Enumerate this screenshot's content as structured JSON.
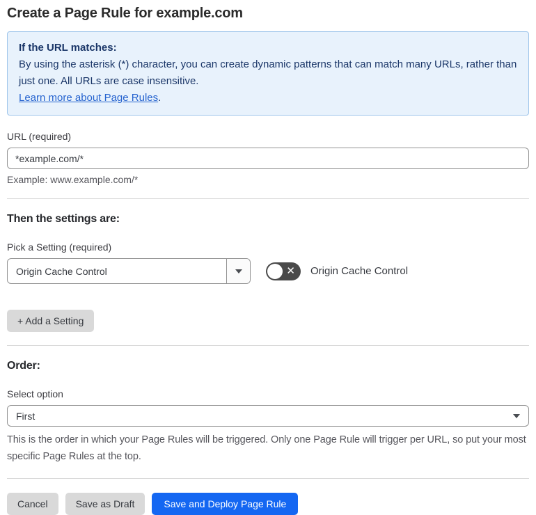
{
  "page": {
    "title": "Create a Page Rule for example.com"
  },
  "info_box": {
    "heading": "If the URL matches:",
    "body": "By using the asterisk (*) character, you can create dynamic patterns that can match many URLs, rather than just one. All URLs are case insensitive.",
    "link_label": "Learn more about Page Rules",
    "link_suffix": "."
  },
  "url_field": {
    "label": "URL (required)",
    "value": "*example.com/*",
    "example": "Example: www.example.com/*"
  },
  "settings": {
    "heading": "Then the settings are:",
    "pick_label": "Pick a Setting (required)",
    "selected_setting": "Origin Cache Control",
    "toggle": {
      "state": "off",
      "symbol": "✕",
      "label": "Origin Cache Control"
    },
    "add_button_label": "+ Add a Setting"
  },
  "order": {
    "heading": "Order:",
    "select_label": "Select option",
    "selected_option": "First",
    "help": "This is the order in which your Page Rules will be triggered. Only one Page Rule will trigger per URL, so put your most specific Page Rules at the top."
  },
  "footer": {
    "cancel_label": "Cancel",
    "save_draft_label": "Save as Draft",
    "save_deploy_label": "Save and Deploy Page Rule"
  },
  "colors": {
    "primary_blue": "#1467f2",
    "info_background": "#e8f2fc",
    "info_border": "#9dc4ea",
    "info_text": "#1a3668",
    "link_blue": "#2563cf",
    "toggle_off_gray": "#4a4a4a",
    "button_gray": "#d9d9d9"
  }
}
